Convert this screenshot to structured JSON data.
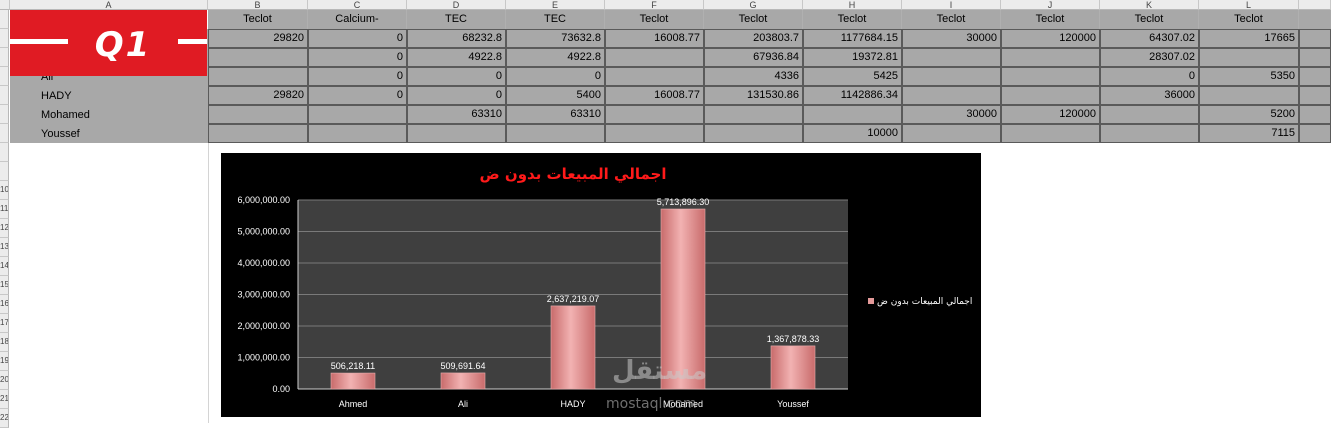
{
  "spreadsheet": {
    "col_headers": [
      "A",
      "B",
      "C",
      "D",
      "E",
      "F",
      "G",
      "H",
      "I",
      "J",
      "K",
      "L"
    ],
    "row_numbers": [
      "",
      "",
      "",
      "",
      "",
      "",
      "",
      "",
      "",
      "10",
      "11",
      "12",
      "13",
      "14",
      "15",
      "16",
      "17",
      "18",
      "19",
      "20",
      "21",
      "22"
    ],
    "header_row": [
      "",
      "Teclot",
      "Calcium-",
      "TEC",
      "TEC",
      "Teclot",
      "Teclot",
      "Teclot",
      "Teclot",
      "Teclot",
      "Teclot",
      "Teclot"
    ],
    "rows": [
      {
        "name": "",
        "cells": [
          "29820",
          "0",
          "68232.8",
          "73632.8",
          "16008.77",
          "203803.7",
          "1177684.15",
          "30000",
          "120000",
          "64307.02",
          "17665"
        ]
      },
      {
        "name": "",
        "cells": [
          "",
          "0",
          "4922.8",
          "4922.8",
          "",
          "67936.84",
          "19372.81",
          "",
          "",
          "28307.02",
          ""
        ]
      },
      {
        "name": "Ali",
        "cells": [
          "",
          "0",
          "0",
          "0",
          "",
          "4336",
          "5425",
          "",
          "",
          "0",
          "5350"
        ]
      },
      {
        "name": "HADY",
        "cells": [
          "29820",
          "0",
          "0",
          "5400",
          "16008.77",
          "131530.86",
          "1142886.34",
          "",
          "",
          "36000",
          ""
        ]
      },
      {
        "name": "Mohamed",
        "cells": [
          "",
          "",
          "63310",
          "63310",
          "",
          "",
          "",
          "30000",
          "120000",
          "",
          "5200"
        ]
      },
      {
        "name": "Youssef",
        "cells": [
          "",
          "",
          "",
          "",
          "",
          "",
          "10000",
          "",
          "",
          "",
          "7115"
        ]
      }
    ]
  },
  "logo": {
    "text": "Q1"
  },
  "watermark": {
    "arabic": "مستقل",
    "latin": "mostaql.com"
  },
  "chart_data": {
    "type": "bar",
    "title": "اجمالي المبيعات بدون ض",
    "categories": [
      "Ahmed",
      "Ali",
      "HADY",
      "Mohamed",
      "Youssef"
    ],
    "series": [
      {
        "name": "اجمالي المبيعات بدون ض",
        "values": [
          506218.11,
          509691.64,
          2637219.07,
          5713896.3,
          1367878.33
        ]
      }
    ],
    "data_labels": [
      "506,218.11",
      "509,691.64",
      "2,637,219.07",
      "5,713,896.30",
      "1,367,878.33"
    ],
    "y_ticks": [
      "0.00",
      "1,000,000.00",
      "2,000,000.00",
      "3,000,000.00",
      "4,000,000.00",
      "5,000,000.00",
      "6,000,000.00"
    ],
    "ylim": [
      0,
      6000000
    ],
    "grid": true,
    "legend": "right",
    "colors": {
      "bar": "#e49a9a",
      "title": "#ff1a1a",
      "background": "#000000",
      "plot": "#3f3f3f"
    }
  }
}
